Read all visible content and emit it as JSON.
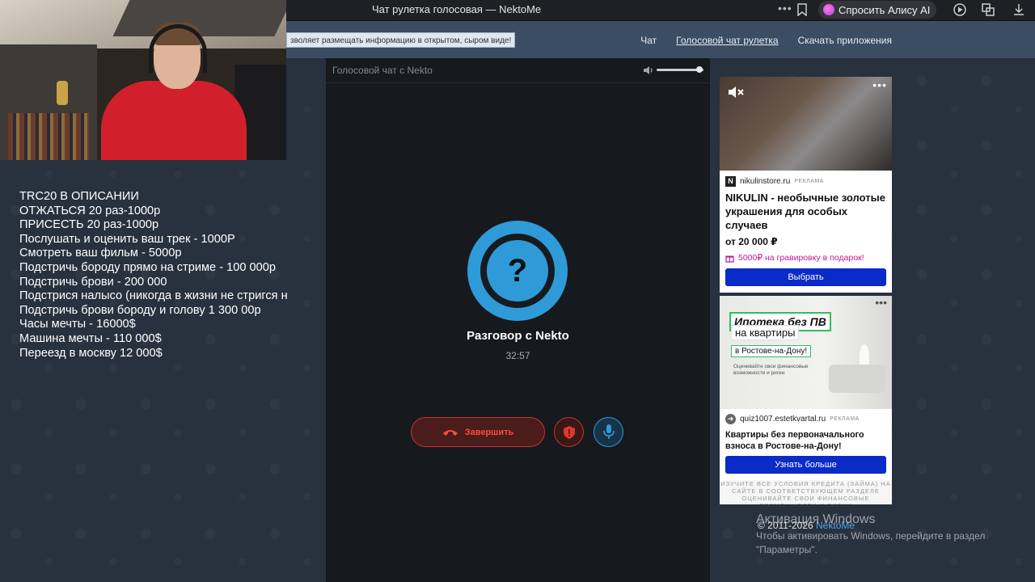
{
  "browser": {
    "title": "Чат рулетка голосовая — NektoMe",
    "menu_dots": "•••",
    "alice_button": "Спросить Алису AI"
  },
  "site": {
    "notice": "зволяет размещать информацию в открытом, сыром виде!",
    "nav": [
      "Чат",
      "Голосовой чат рулетка",
      "Скачать приложения"
    ]
  },
  "overlay": {
    "lines": [
      "TRC20 В ОПИСАНИИ",
      "ОТЖАТЬСЯ 20 раз-1000р",
      "ПРИСЕСТЬ 20 раз-1000р",
      "Послушать и оценить ваш трек - 1000Р",
      "Смотреть ваш фильм - 5000р",
      "Подстричь бороду прямо на стриме - 100 000р",
      "Подстричь брови - 200 000",
      "Подстрися налысо (никогда в жизни не стригся н",
      "Подстричь брови бороду и голову 1 300 00р",
      "Часы мечты - 16000$",
      "Машина мечты - 110 000$",
      "Переезд в москву 12 000$"
    ]
  },
  "chat": {
    "panel_title": "Голосовой чат с Nekto",
    "volume_level": 0.92,
    "avatar_symbol": "?",
    "conversation_title": "Разговор с Nekto",
    "timer": "32:57",
    "end_button": "Завершить"
  },
  "ads": {
    "ad1": {
      "dots": "•••",
      "domain": "nikulinstore.ru",
      "tag": "РЕКЛАМА",
      "title": "NIKULIN - необычные золотые украшения для особых случаев",
      "price": "от 20 000 ₽",
      "promo": "5000₽ на гравировку в подарок!",
      "button": "Выбрать"
    },
    "ad2": {
      "dots": "•••",
      "badge1": "Ипотека без ПВ",
      "badge2": "на квартиры",
      "badge3": "в Ростове-на-Дону!",
      "small": "Оценивайте свои финансовые возможности и риски",
      "domain": "quiz1007.estetkvartal.ru",
      "tag": "РЕКЛАМА",
      "title": "Квартиры без первоначального взноса в Ростове-на-Дону!",
      "button": "Узнать больше",
      "disclaimer": "ИЗУЧИТЕ ВСЕ УСЛОВИЯ КРЕДИТА (ЗАЙМА) НА САЙТЕ В СООТВЕТСТВУЮЩЕМ РАЗДЕЛЕ ОЦЕНИВАЙТЕ СВОИ ФИНАНСОВЫЕ ВОЗМОЖНОСТИ И РИСКИ"
    }
  },
  "footer": {
    "copyright": "© 2011-2026",
    "brand": "NektoMe"
  },
  "watermark": {
    "title": "Активация Windows",
    "line1": "Чтобы активировать Windows, перейдите в раздел",
    "line2": "\"Параметры\"."
  },
  "colors": {
    "accent_blue": "#2e9bd8",
    "danger_red": "#c0352c",
    "ad_button": "#0a2bc7"
  }
}
